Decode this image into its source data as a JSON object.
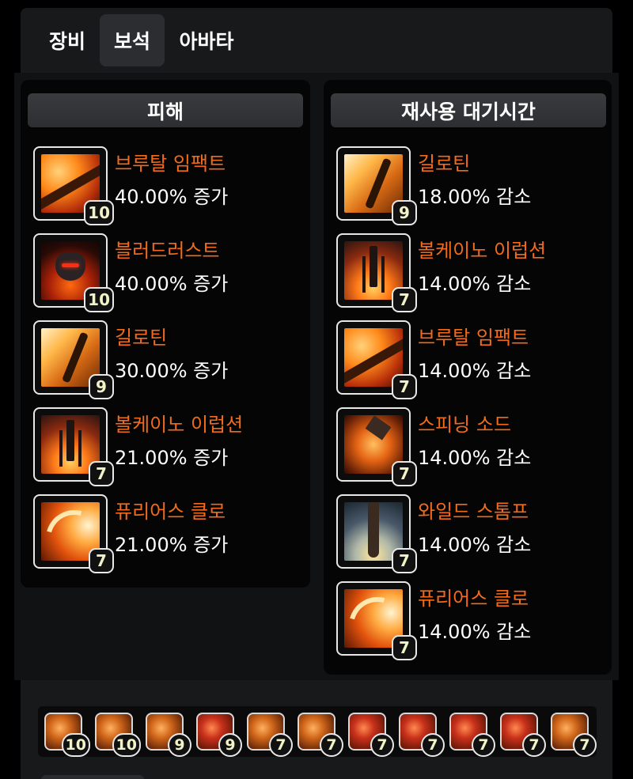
{
  "tabs": [
    {
      "label": "장비"
    },
    {
      "label": "보석"
    },
    {
      "label": "아바타"
    }
  ],
  "left_panel": {
    "header": "피해",
    "items": [
      {
        "name": "브루탈 임팩트",
        "value": "40.00% 증가",
        "level": "10",
        "icon": "brutal-impact-icon"
      },
      {
        "name": "블러드러스트",
        "value": "40.00% 증가",
        "level": "10",
        "icon": "bloodlust-icon"
      },
      {
        "name": "길로틴",
        "value": "30.00% 증가",
        "level": "9",
        "icon": "guillotine-icon"
      },
      {
        "name": "볼케이노 이럽션",
        "value": "21.00% 증가",
        "level": "7",
        "icon": "volcano-eruption-icon"
      },
      {
        "name": "퓨리어스 클로",
        "value": "21.00% 증가",
        "level": "7",
        "icon": "furious-claw-icon"
      }
    ]
  },
  "right_panel": {
    "header": "재사용 대기시간",
    "items": [
      {
        "name": "길로틴",
        "value": "18.00% 감소",
        "level": "9",
        "icon": "guillotine-icon"
      },
      {
        "name": "볼케이노 이럽션",
        "value": "14.00% 감소",
        "level": "7",
        "icon": "volcano-eruption-icon"
      },
      {
        "name": "브루탈 임팩트",
        "value": "14.00% 감소",
        "level": "7",
        "icon": "brutal-impact-icon"
      },
      {
        "name": "스피닝 소드",
        "value": "14.00% 감소",
        "level": "7",
        "icon": "spinning-sword-icon"
      },
      {
        "name": "와일드 스톰프",
        "value": "14.00% 감소",
        "level": "7",
        "icon": "wild-stomp-icon"
      },
      {
        "name": "퓨리어스 클로",
        "value": "14.00% 감소",
        "level": "7",
        "icon": "furious-claw-icon"
      }
    ]
  },
  "gems": [
    {
      "level": "10",
      "icon": "gem-icon"
    },
    {
      "level": "10",
      "icon": "gem-icon"
    },
    {
      "level": "9",
      "icon": "gem-icon"
    },
    {
      "level": "9",
      "icon": "gem-icon"
    },
    {
      "level": "7",
      "icon": "gem-icon"
    },
    {
      "level": "7",
      "icon": "gem-icon"
    },
    {
      "level": "7",
      "icon": "gem-icon"
    },
    {
      "level": "7",
      "icon": "gem-icon"
    },
    {
      "level": "7",
      "icon": "gem-icon"
    },
    {
      "level": "7",
      "icon": "gem-icon"
    },
    {
      "level": "7",
      "icon": "gem-icon"
    }
  ],
  "colors": {
    "skill_name": "#f26b1d",
    "level_text": "#f2f2c8",
    "background": "#000000"
  }
}
